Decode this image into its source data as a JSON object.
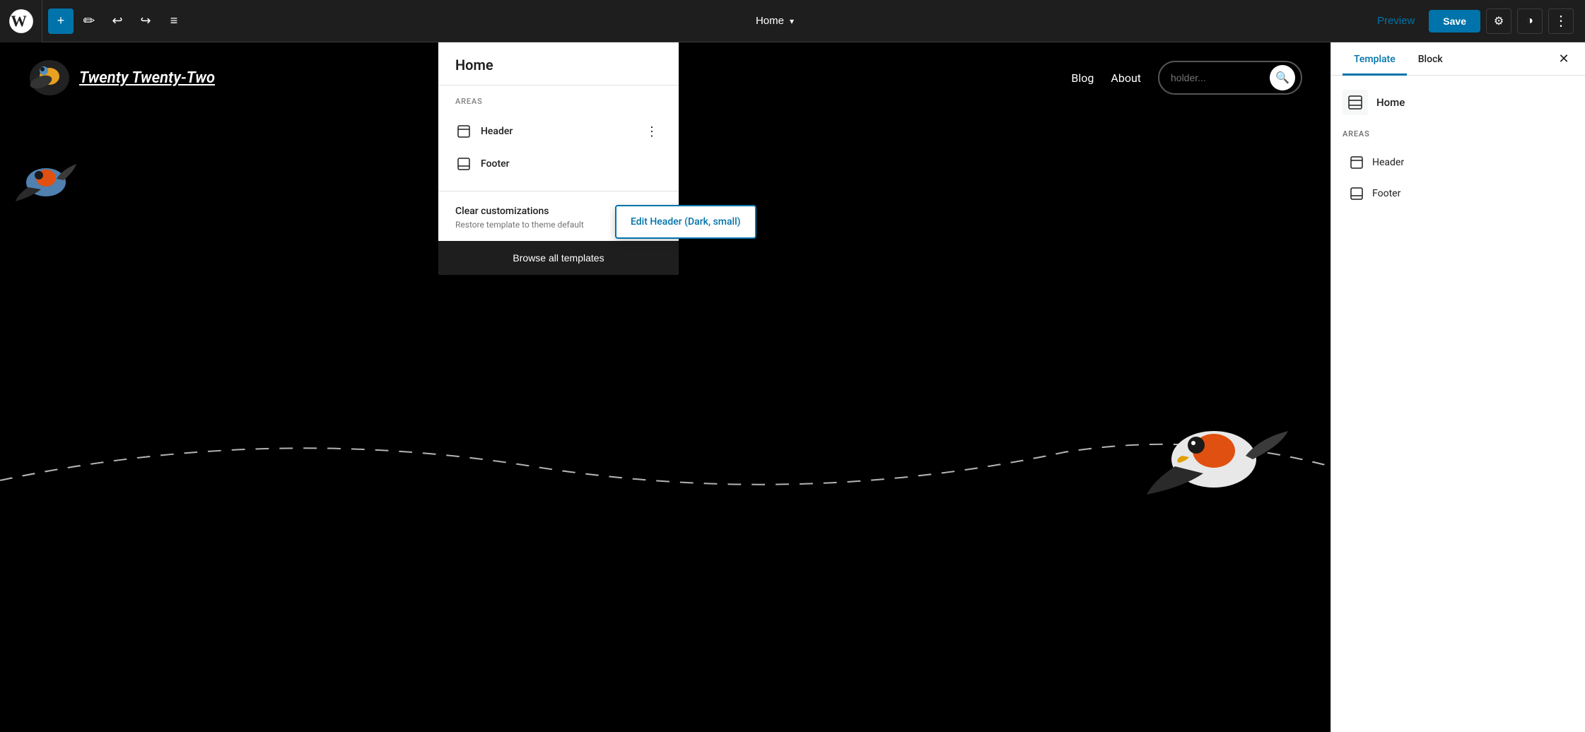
{
  "topbar": {
    "add_label": "+",
    "undo_label": "↩",
    "redo_label": "↪",
    "list_label": "≡",
    "page_title": "Home",
    "chevron_down": "▾",
    "preview_label": "Preview",
    "save_label": "Save",
    "gear_symbol": "⚙",
    "contrast_symbol": "◑",
    "more_symbol": "⋮"
  },
  "canvas": {
    "site_title": "Twenty Twenty-Two",
    "nav_items": [
      "Blog",
      "About"
    ],
    "search_placeholder": "holder...",
    "search_icon": "🔍"
  },
  "dropdown": {
    "title": "Home",
    "areas_label": "AREAS",
    "areas": [
      {
        "name": "Header",
        "icon": "⬜"
      },
      {
        "name": "Footer",
        "icon": "⬜"
      }
    ],
    "more_icon": "⋮",
    "clear_title": "Clear customizations",
    "clear_subtitle": "Restore template to theme default",
    "browse_all_label": "Browse all templates"
  },
  "context_menu": {
    "item": "Edit Header (Dark, small)"
  },
  "right_panel": {
    "tab_template": "Template",
    "tab_block": "Block",
    "close_icon": "✕",
    "template_name": "Home",
    "template_icon": "⬜",
    "areas_label": "AREAS",
    "areas": [
      {
        "name": "Header",
        "icon": "⬜"
      },
      {
        "name": "Footer",
        "icon": "⬜"
      }
    ]
  }
}
